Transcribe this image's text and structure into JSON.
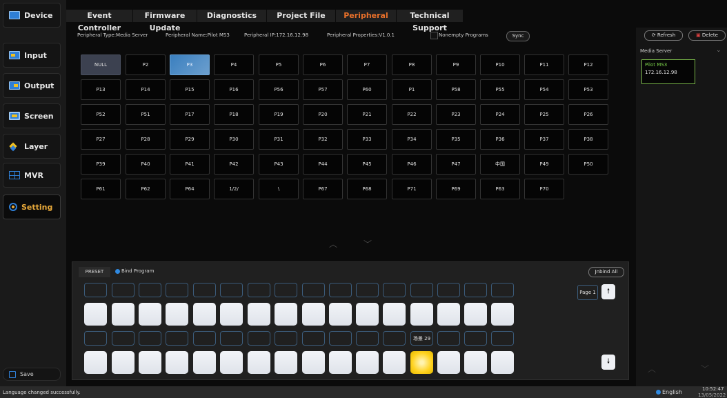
{
  "sidebar": {
    "items": [
      {
        "label": "Device",
        "icon": "device-icon"
      },
      {
        "label": "Input",
        "icon": "input-icon"
      },
      {
        "label": "Output",
        "icon": "output-icon"
      },
      {
        "label": "Screen",
        "icon": "screen-icon"
      },
      {
        "label": "Layer",
        "icon": "layer-icon"
      },
      {
        "label": "MVR",
        "icon": "mvr-icon"
      },
      {
        "label": "Setting",
        "icon": "gear-icon"
      }
    ],
    "save_label": "Save"
  },
  "tabs": [
    {
      "label": "Event Controller"
    },
    {
      "label": "Firmware Update"
    },
    {
      "label": "Diagnostics"
    },
    {
      "label": "Project File"
    },
    {
      "label": "Peripheral"
    },
    {
      "label": "Technical Support"
    }
  ],
  "info": {
    "type": "Peripheral Type:Media Server",
    "name": "Peripheral Name:Pilot MS3",
    "ip": "Peripheral IP:172.16.12.98",
    "properties": "Peripheral Properties:V1.0.1",
    "nonempty_label": "Nonempty Programs",
    "sync_label": "Sync"
  },
  "programs": [
    [
      "NULL",
      "P2",
      "P3",
      "P4",
      "P5",
      "P6",
      "P7",
      "P8",
      "P9",
      "P10",
      "P11",
      "P12"
    ],
    [
      "P13",
      "P14",
      "P15",
      "P16",
      "P56",
      "P57",
      "P60",
      "P1",
      "P58",
      "P55",
      "P54",
      "P53"
    ],
    [
      "P52",
      "P51",
      "P17",
      "P18",
      "P19",
      "P20",
      "P21",
      "P22",
      "P23",
      "P24",
      "P25",
      "P26"
    ],
    [
      "P27",
      "P28",
      "P29",
      "P30",
      "P31",
      "P32",
      "P33",
      "P34",
      "P35",
      "P36",
      "P37",
      "P38"
    ],
    [
      "P39",
      "P40",
      "P41",
      "P42",
      "P43",
      "P44",
      "P45",
      "P46",
      "P47",
      "中国",
      "P49",
      "P50"
    ],
    [
      "P61",
      "P62",
      "P64",
      "1/2/",
      "\\",
      "P67",
      "P68",
      "P71",
      "P69",
      "P63",
      "P70"
    ]
  ],
  "preset": {
    "tab_label": "PRESET",
    "bind_label": "Bind Program",
    "unbind_label": "Jnbind All",
    "page_label": "Page 1",
    "up_arrow": "🠕",
    "down_arrow": "🠗",
    "bound_label": "场景 29"
  },
  "right_panel": {
    "refresh_label": "Refresh",
    "delete_label": "Delete",
    "server_type": "Media Server",
    "server_name": "Pilot MS3",
    "server_ip": "172.16.12.98"
  },
  "status": {
    "message": "Language changed successfully.",
    "language": "English",
    "time": "10:52:47",
    "date": "13/05/2022"
  },
  "colors": {
    "accent": "#e8702a",
    "selected_program": "#4a8ac6",
    "server_card_border": "#7ab84a",
    "yellow_pad": "#ffd21f"
  }
}
